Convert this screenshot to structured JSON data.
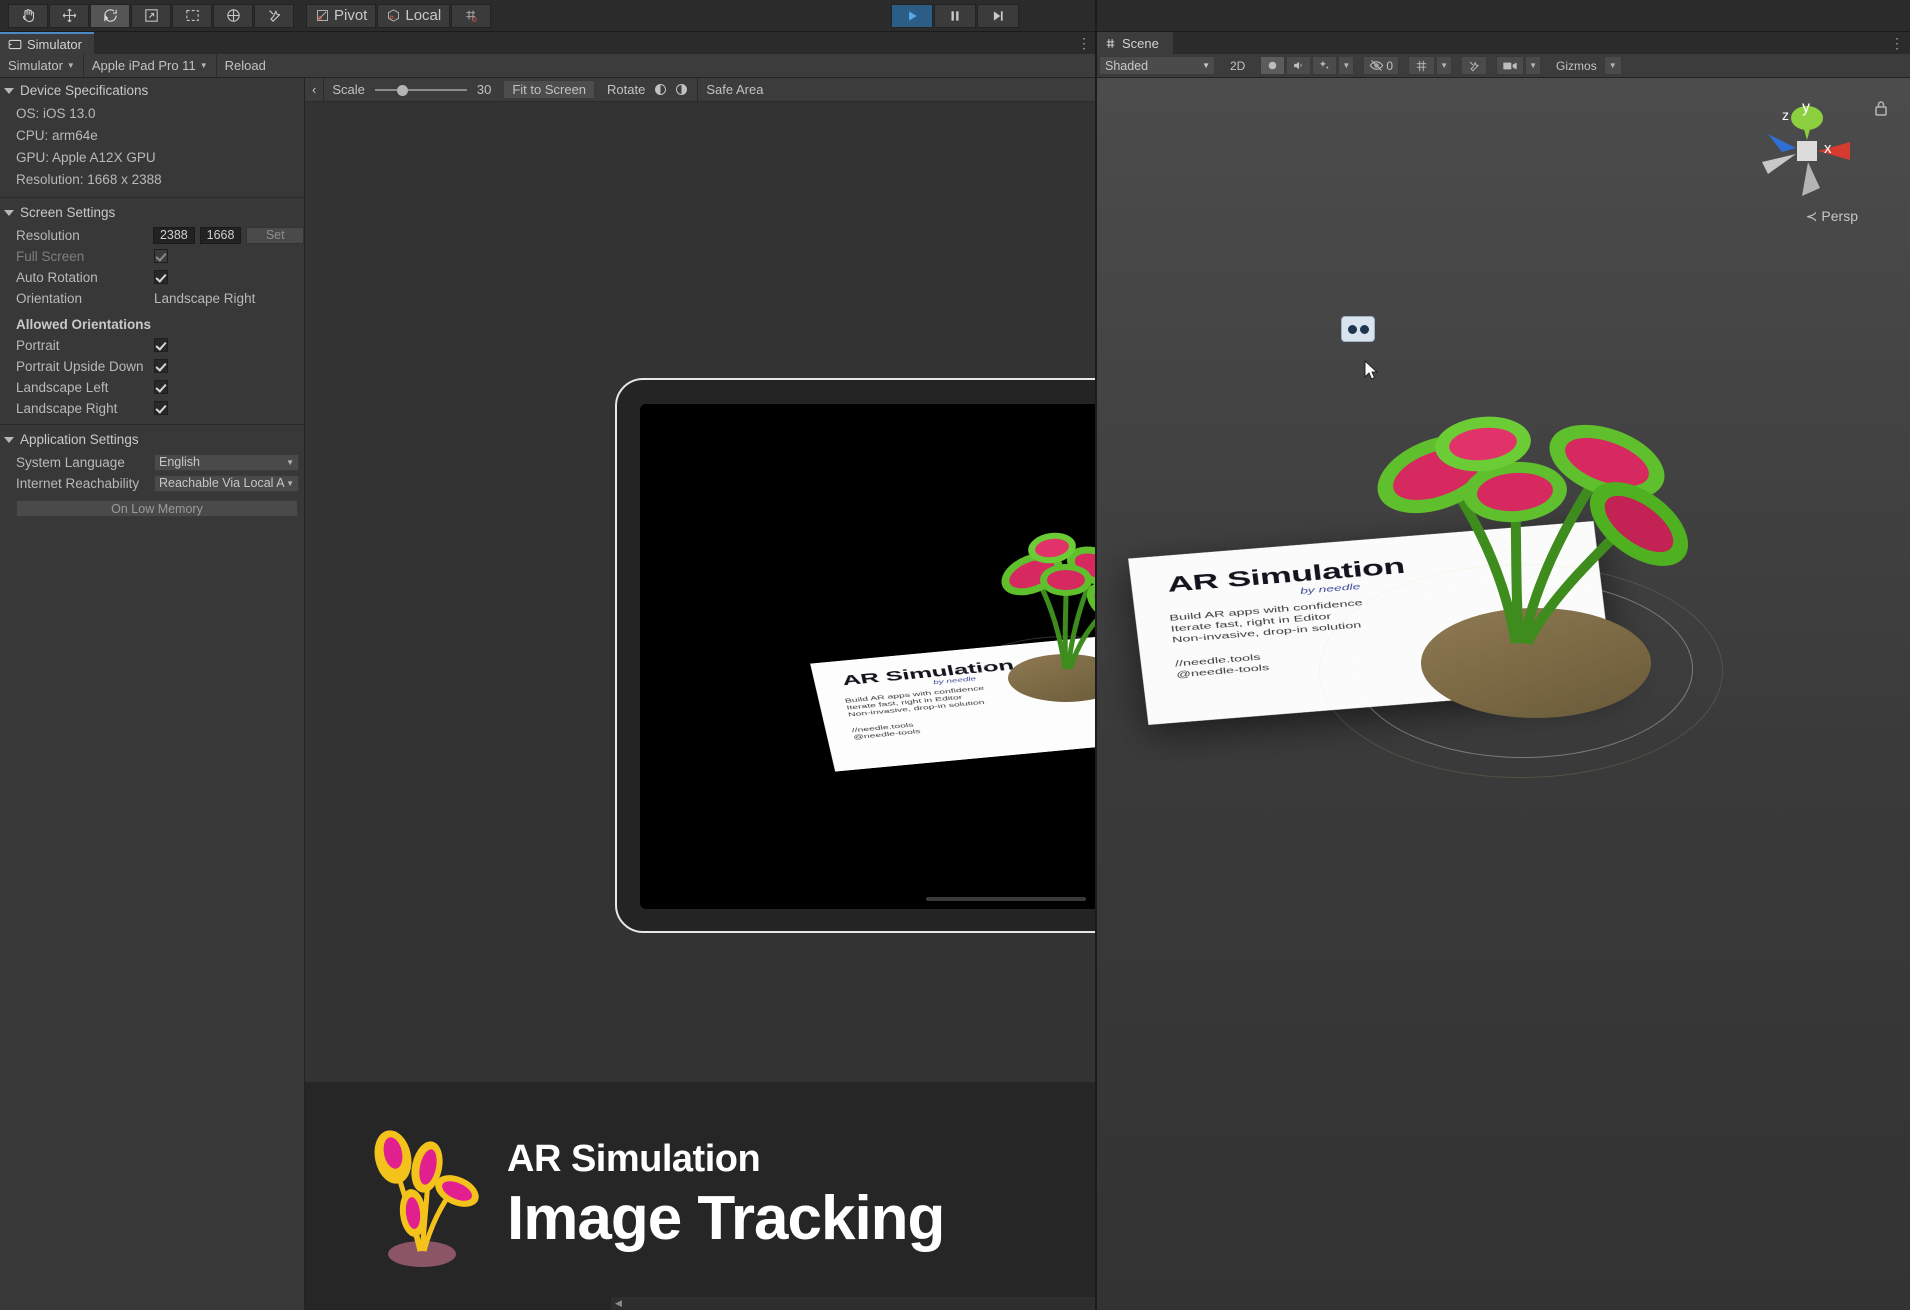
{
  "toolbar": {
    "tools": [
      {
        "name": "hand-tool",
        "icon": "hand",
        "active": false
      },
      {
        "name": "move-tool",
        "icon": "move",
        "active": false
      },
      {
        "name": "rotate-tool",
        "icon": "rotate",
        "active": true
      },
      {
        "name": "scale-tool",
        "icon": "scale",
        "active": false
      },
      {
        "name": "rect-tool",
        "icon": "rect",
        "active": false
      },
      {
        "name": "transform-tool",
        "icon": "transform",
        "active": false
      },
      {
        "name": "custom-tool",
        "icon": "wrench",
        "active": false
      }
    ],
    "pivot_label": "Pivot",
    "handle_label": "Local",
    "snap_label": "",
    "play_label": "▶",
    "pause_label": "❙❙",
    "step_label": "▶❘"
  },
  "simulator_panel": {
    "tab_label": "Simulator",
    "device_dropdown": "Simulator",
    "device_model": "Apple iPad Pro 11",
    "reload_label": "Reload",
    "view_toolbar": {
      "back_arrow": "‹",
      "scale_label": "Scale",
      "scale_value": "30",
      "fit_label": "Fit to Screen",
      "rotate_label": "Rotate",
      "safe_area_label": "Safe Area"
    },
    "device_specifications": {
      "header": "Device Specifications",
      "lines": [
        "OS: iOS 13.0",
        "CPU: arm64e",
        "GPU: Apple A12X GPU",
        "Resolution: 1668 x 2388"
      ]
    },
    "screen_settings": {
      "header": "Screen Settings",
      "resolution_label": "Resolution",
      "resolution_width": "2388",
      "resolution_height": "1668",
      "set_label": "Set",
      "full_screen_label": "Full Screen",
      "full_screen_checked": true,
      "auto_rotation_label": "Auto Rotation",
      "auto_rotation_checked": true,
      "orientation_label": "Orientation",
      "orientation_value": "Landscape Right",
      "allowed_header": "Allowed Orientations",
      "allowed": [
        {
          "label": "Portrait",
          "checked": true
        },
        {
          "label": "Portrait Upside Down",
          "checked": true
        },
        {
          "label": "Landscape Left",
          "checked": true
        },
        {
          "label": "Landscape Right",
          "checked": true
        }
      ]
    },
    "application_settings": {
      "header": "Application Settings",
      "system_language_label": "System Language",
      "system_language_value": "English",
      "internet_reachability_label": "Internet Reachability",
      "internet_reachability_value": "Reachable Via Local A",
      "on_low_memory_label": "On Low Memory"
    }
  },
  "ar_card": {
    "title": "AR Simulation",
    "byline": "by needle",
    "body_line1": "Build AR apps with confidence",
    "body_line2": "Iterate fast, right in Editor",
    "body_line3": "Non-invasive, drop-in solution",
    "link1": "//needle.tools",
    "link2": "@needle-tools"
  },
  "footer": {
    "eyebrow": "AR Simulation",
    "title": "Image Tracking"
  },
  "scene_panel": {
    "tab_label": "Scene",
    "shading_mode": "Shaded",
    "two_d_label": "2D",
    "lighting_icon": "light-bulb-icon",
    "audio_icon": "audio-icon",
    "fx_icon": "effects-icon",
    "hidden_count": "0",
    "grid_icon": "grid-icon",
    "tools_icon": "scene-tools-icon",
    "camera_icon": "scene-camera-icon",
    "gizmos_label": "Gizmos",
    "persp_label": "≺ Persp",
    "axis_x": "x",
    "axis_y": "y",
    "axis_z": "z"
  },
  "colors": {
    "background": "#383838",
    "toolbar": "#2b2b2b",
    "accent_tab": "#4a8ac7",
    "play_active": "#2c5d87",
    "axis_x": "#d63b2f",
    "axis_y": "#8ccf3f",
    "axis_z": "#2f6fd6",
    "card_paper": "#fdfdfd",
    "leaf_green": "#5fbf2d",
    "leaf_pink": "#d6295f",
    "pot_brown": "#7d6b45"
  }
}
